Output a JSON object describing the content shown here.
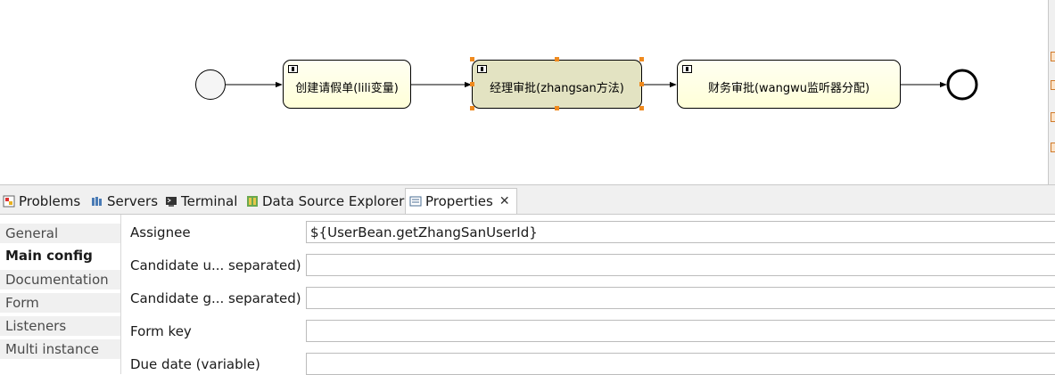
{
  "diagram": {
    "tasks": [
      {
        "label": "创建请假单(lili变量)"
      },
      {
        "label": "经理审批(zhangsan方法)"
      },
      {
        "label": "财务审批(wangwu监听器分配)"
      }
    ]
  },
  "tabs": [
    {
      "label": "Problems",
      "icon": "problems-icon"
    },
    {
      "label": "Servers",
      "icon": "servers-icon"
    },
    {
      "label": "Terminal",
      "icon": "terminal-icon"
    },
    {
      "label": "Data Source Explorer",
      "icon": "data-source-icon"
    },
    {
      "label": "Properties",
      "icon": "properties-icon",
      "active": true
    }
  ],
  "sections": [
    {
      "label": "General"
    },
    {
      "label": "Main config",
      "active": true
    },
    {
      "label": "Documentation"
    },
    {
      "label": "Form"
    },
    {
      "label": "Listeners"
    },
    {
      "label": "Multi instance"
    }
  ],
  "fields": [
    {
      "label": "Assignee",
      "value": "${UserBean.getZhangSanUserId}"
    },
    {
      "label": "Candidate u... separated)",
      "value": ""
    },
    {
      "label": "Candidate g... separated)",
      "value": ""
    },
    {
      "label": "Form key",
      "value": ""
    },
    {
      "label": "Due date (variable)",
      "value": ""
    }
  ],
  "colors": {
    "task_fill": "#ffffd8",
    "task_selected_fill": "#e3e3c2",
    "selection_handle": "#f08a1e",
    "panel_bg": "#f0f0f0"
  }
}
